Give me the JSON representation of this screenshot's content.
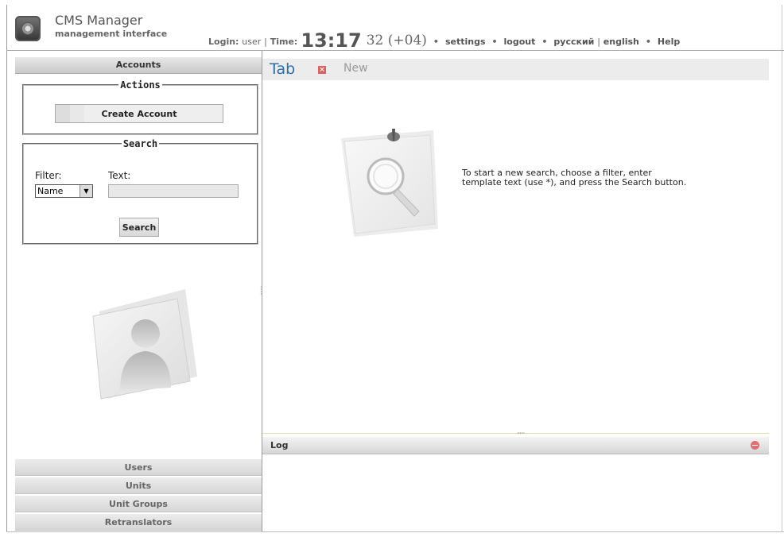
{
  "header": {
    "app_title": "CMS Manager",
    "app_subtitle": "management interface",
    "login_label": "Login:",
    "login_user": "user",
    "sep": "|",
    "time_label": "Time:",
    "time_hm": "13:17",
    "time_rest": "32 (+04)",
    "links": {
      "settings": "settings",
      "logout": "logout",
      "lang_ru": "русский",
      "lang_en": "english",
      "help": "Help"
    }
  },
  "left": {
    "accounts_title": "Accounts",
    "actions_legend": "Actions",
    "create_account": "Create Account",
    "search_legend": "Search",
    "filter_label": "Filter:",
    "text_label": "Text:",
    "filter_value": "Name",
    "search_button": "Search",
    "nav": [
      "Users",
      "Units",
      "Unit Groups",
      "Retranslators"
    ]
  },
  "tabs": {
    "active_label": "Tab",
    "new_label": "New"
  },
  "main": {
    "hint": "To start a new search, choose a filter, enter template text (use *), and press the Search button."
  },
  "log": {
    "title": "Log"
  }
}
